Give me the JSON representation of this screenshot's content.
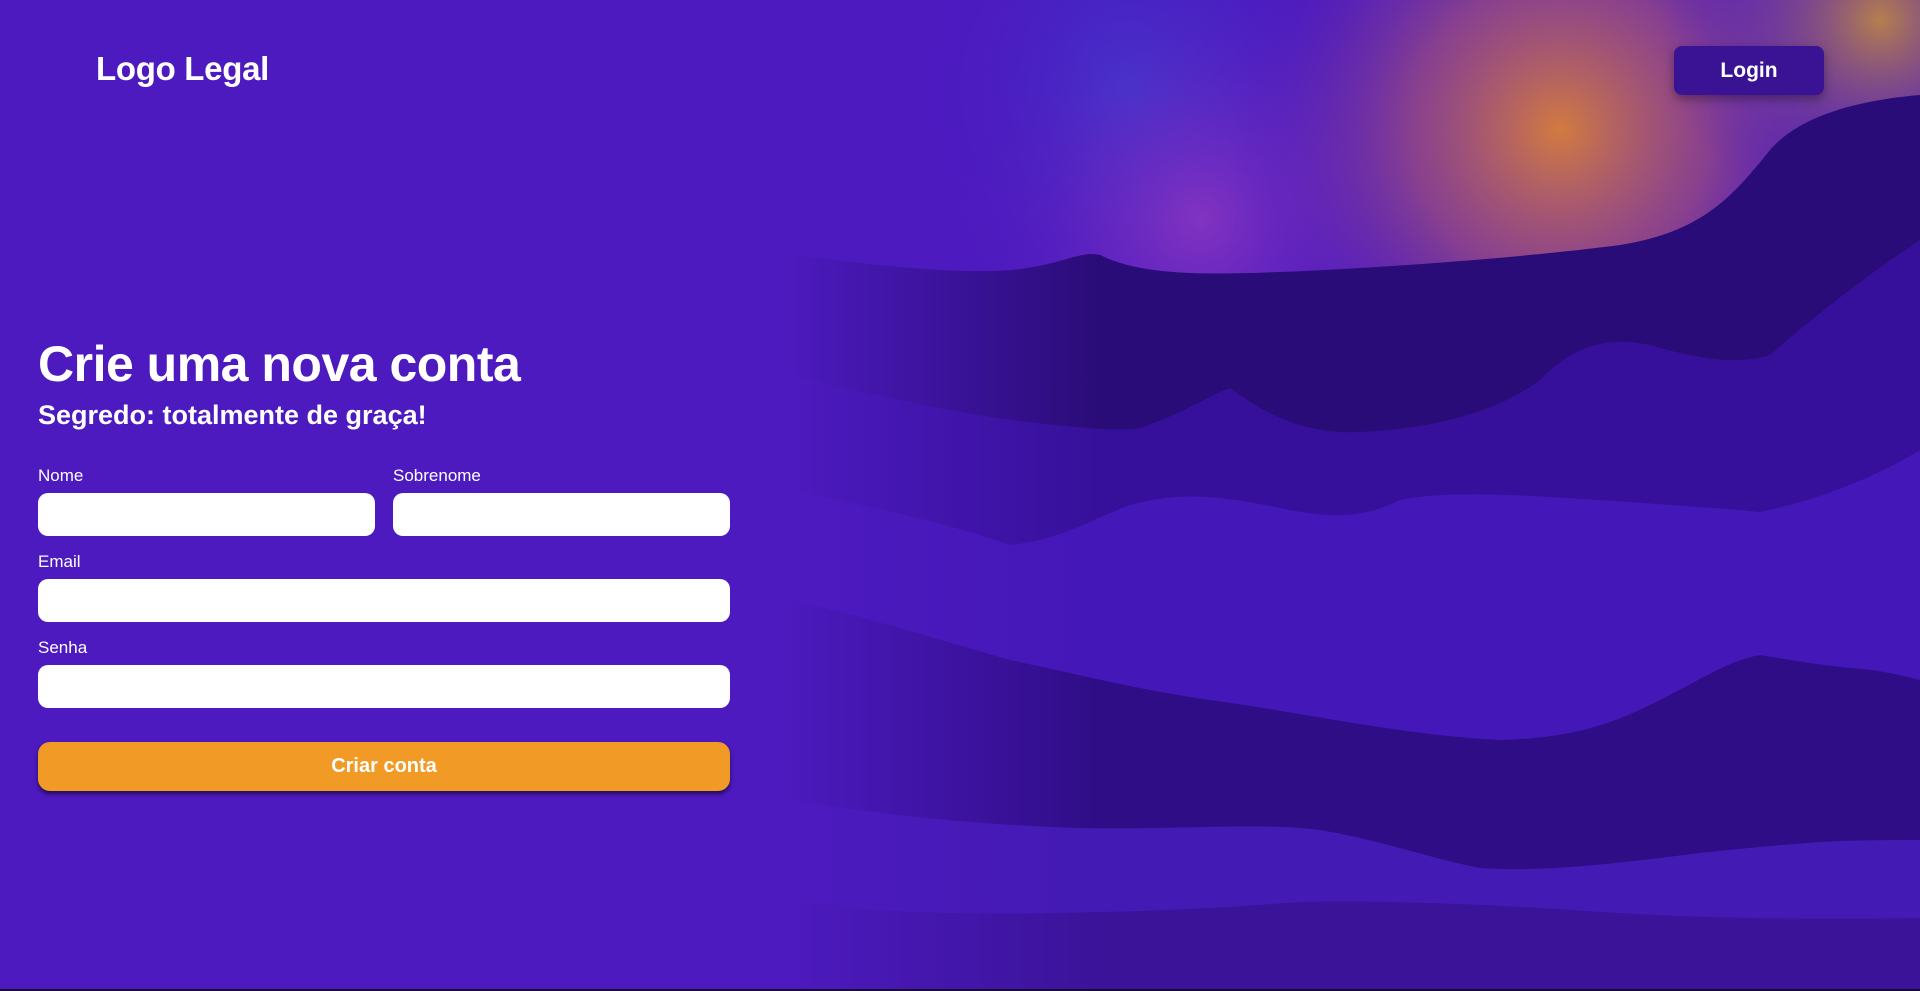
{
  "header": {
    "logo_text": "Logo Legal",
    "login_label": "Login"
  },
  "form": {
    "title": "Crie uma nova conta",
    "subtitle": "Segredo: totalmente de graça!",
    "fields": {
      "first_name": {
        "label": "Nome",
        "value": ""
      },
      "last_name": {
        "label": "Sobrenome",
        "value": ""
      },
      "email": {
        "label": "Email",
        "value": ""
      },
      "password": {
        "label": "Senha",
        "value": ""
      }
    },
    "submit_label": "Criar conta"
  },
  "colors": {
    "background": "#4d1abf",
    "login_button": "#3a1294",
    "submit_button": "#f29a26",
    "text": "#ffffff",
    "input_background": "#ffffff"
  }
}
